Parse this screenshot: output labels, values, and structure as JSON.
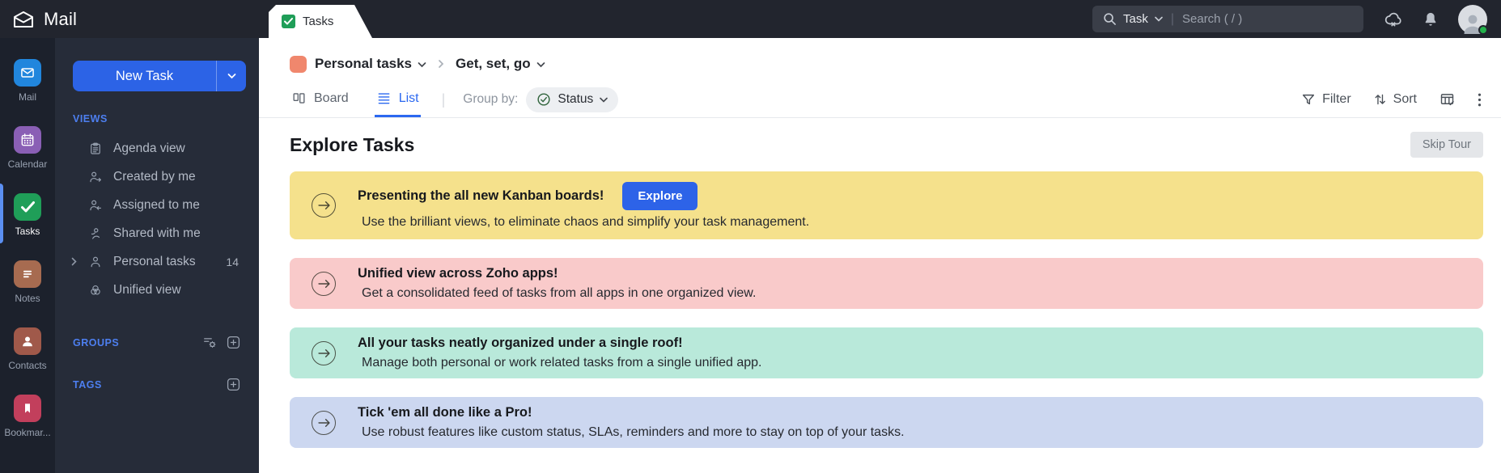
{
  "topbar": {
    "app_title": "Mail",
    "tab_label": "Tasks",
    "search": {
      "scope": "Task",
      "placeholder": "Search ( / )"
    }
  },
  "rail": {
    "items": [
      {
        "label": "Mail",
        "color": "#2186dd"
      },
      {
        "label": "Calendar",
        "color": "#8a5fb5"
      },
      {
        "label": "Tasks",
        "color": "#1f9e58"
      },
      {
        "label": "Notes",
        "color": "#a76b50"
      },
      {
        "label": "Contacts",
        "color": "#a0594a"
      },
      {
        "label": "Bookmar...",
        "color": "#c23f5c"
      }
    ]
  },
  "sidebar": {
    "new_task_label": "New Task",
    "views_header": "VIEWS",
    "views": [
      {
        "label": "Agenda view"
      },
      {
        "label": "Created by me"
      },
      {
        "label": "Assigned to me"
      },
      {
        "label": "Shared with me"
      },
      {
        "label": "Personal tasks",
        "count": "14"
      },
      {
        "label": "Unified view"
      }
    ],
    "groups_header": "GROUPS",
    "tags_header": "TAGS"
  },
  "header": {
    "breadcrumb": {
      "parent": "Personal tasks",
      "current": "Get, set, go",
      "separator": "›",
      "swatch_color": "#f0876d"
    },
    "view_board": "Board",
    "view_list": "List",
    "group_by_label": "Group by:",
    "group_by_value": "Status",
    "filter_label": "Filter",
    "sort_label": "Sort"
  },
  "main": {
    "title": "Explore Tasks",
    "skip_tour_label": "Skip Tour",
    "banners": [
      {
        "title": "Presenting the all new Kanban boards!",
        "subtitle": "Use the brilliant views, to eliminate chaos and simplify your task management.",
        "button_label": "Explore",
        "bg": "#f5e18c"
      },
      {
        "title": "Unified view across Zoho apps!",
        "subtitle": "Get a consolidated feed of tasks from all apps in one organized view.",
        "bg": "#f9caca"
      },
      {
        "title": "All your tasks neatly organized under a single roof!",
        "subtitle": "Manage both personal or work related tasks from a single unified app.",
        "bg": "#b9e9da"
      },
      {
        "title": "Tick 'em all done like a Pro!",
        "subtitle": "Use robust features like custom status, SLAs, reminders and more to stay on top of your tasks.",
        "bg": "#ccd7f0"
      }
    ]
  },
  "colors": {
    "topbar_bg": "#22252e",
    "rail_bg": "#1c212c",
    "sidebar_bg": "#262c39",
    "accent_blue": "#2c63e6",
    "active_indicator": "#5b8ff2",
    "header_link_blue": "#4d7ff0"
  }
}
